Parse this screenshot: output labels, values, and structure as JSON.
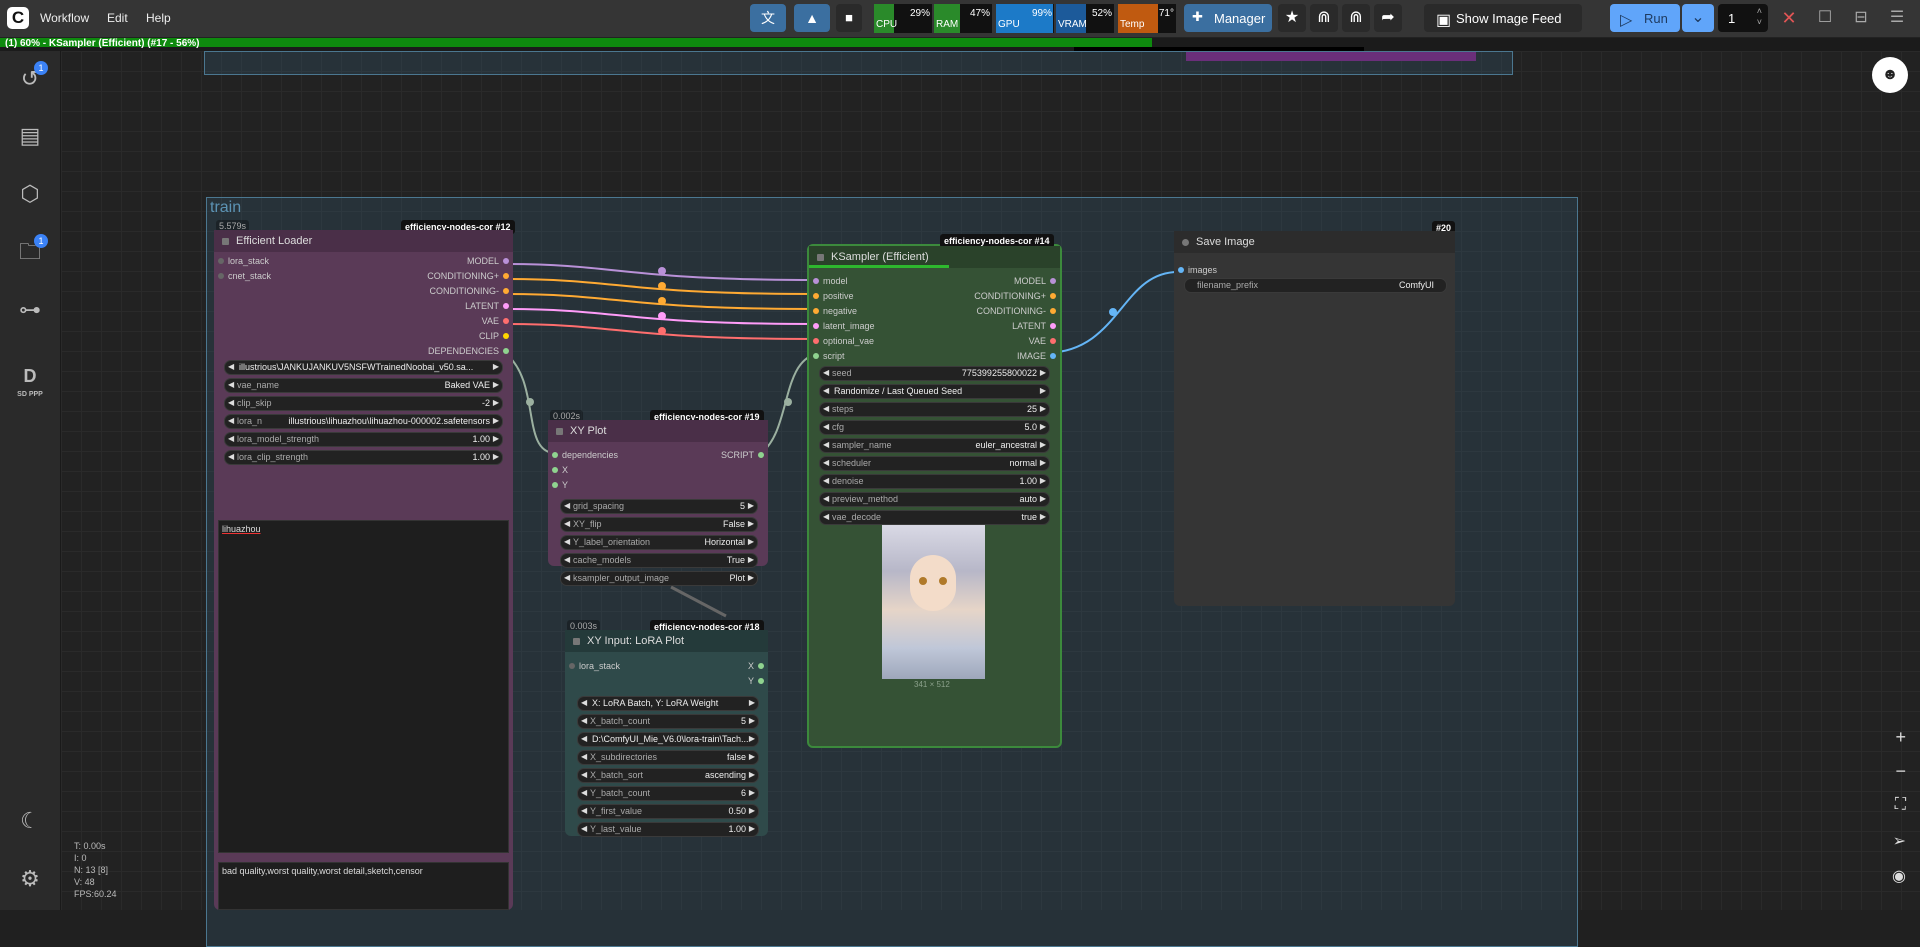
{
  "menu": {
    "workflow": "Workflow",
    "edit": "Edit",
    "help": "Help"
  },
  "stats": {
    "cpu": {
      "label": "CPU",
      "value": "29%",
      "pct": 29
    },
    "ram": {
      "label": "RAM",
      "value": "47%",
      "pct": 47
    },
    "gpu": {
      "label": "GPU",
      "value": "99%",
      "pct": 99
    },
    "vram": {
      "label": "VRAM",
      "value": "52%",
      "pct": 52
    },
    "temp": {
      "label": "Temp",
      "value": "71°",
      "pct": 71
    }
  },
  "toolbar": {
    "manager": "Manager",
    "show_feed": "Show Image Feed",
    "run": "Run",
    "queue_count": "1"
  },
  "progress": {
    "text": "(1) 60% - KSampler (Efficient) (#17 - 56%)",
    "value": 60
  },
  "sidebar": {
    "queue_badge": "1",
    "assets_badge": "1",
    "sd_label": "SD PPP"
  },
  "group": {
    "title": "train"
  },
  "loader": {
    "tag": "efficiency-nodes-cor  #12",
    "time": "5.579s",
    "title": "Efficient Loader",
    "inputs": [
      "lora_stack",
      "cnet_stack"
    ],
    "outputs": [
      "MODEL",
      "CONDITIONING+",
      "CONDITIONING-",
      "LATENT",
      "VAE",
      "CLIP",
      "DEPENDENCIES"
    ],
    "widgets": [
      {
        "label": "",
        "value": "illustrious\\JANKUJANKUV5NSFWTrainedNoobai_v50.sa..."
      },
      {
        "label": "vae_name",
        "value": "Baked VAE"
      },
      {
        "label": "clip_skip",
        "value": "-2"
      },
      {
        "label": "lora_n",
        "value": "illustrious\\lihuazhou\\lihuazhou-000002.safetensors"
      },
      {
        "label": "lora_model_strength",
        "value": "1.00"
      },
      {
        "label": "lora_clip_strength",
        "value": "1.00"
      }
    ],
    "positive": "lihuazhou",
    "negative": "bad quality,worst quality,worst detail,sketch,censor"
  },
  "xyplot": {
    "tag": "efficiency-nodes-cor  #19",
    "time": "0.002s",
    "title": "XY Plot",
    "inputs": [
      "dependencies",
      "X",
      "Y"
    ],
    "output": "SCRIPT",
    "widgets": [
      {
        "label": "grid_spacing",
        "value": "5"
      },
      {
        "label": "XY_flip",
        "value": "False"
      },
      {
        "label": "Y_label_orientation",
        "value": "Horizontal"
      },
      {
        "label": "cache_models",
        "value": "True"
      },
      {
        "label": "ksampler_output_image",
        "value": "Plot"
      }
    ]
  },
  "xyinput": {
    "tag": "efficiency-nodes-cor  #18",
    "time": "0.003s",
    "title": "XY Input: LoRA Plot",
    "input": "lora_stack",
    "outputs": [
      "X",
      "Y"
    ],
    "widgets": [
      {
        "label": "",
        "value": "X: LoRA Batch, Y: LoRA Weight"
      },
      {
        "label": "X_batch_count",
        "value": "5"
      },
      {
        "label": "",
        "value": "D:\\ComfyUI_Mie_V6.0\\lora-train\\Tach..."
      },
      {
        "label": "X_subdirectories",
        "value": "false"
      },
      {
        "label": "X_batch_sort",
        "value": "ascending"
      },
      {
        "label": "Y_batch_count",
        "value": "6"
      },
      {
        "label": "Y_first_value",
        "value": "0.50"
      },
      {
        "label": "Y_last_value",
        "value": "1.00"
      }
    ]
  },
  "ksampler": {
    "tag": "efficiency-nodes-cor  #14",
    "title": "KSampler (Efficient)",
    "inputs": [
      "model",
      "positive",
      "negative",
      "latent_image",
      "optional_vae",
      "script"
    ],
    "outputs": [
      "MODEL",
      "CONDITIONING+",
      "CONDITIONING-",
      "LATENT",
      "VAE",
      "IMAGE"
    ],
    "widgets": [
      {
        "label": "seed",
        "value": "775399255800022"
      },
      {
        "label": "",
        "value": "Randomize / Last Queued Seed"
      },
      {
        "label": "steps",
        "value": "25"
      },
      {
        "label": "cfg",
        "value": "5.0"
      },
      {
        "label": "sampler_name",
        "value": "euler_ancestral"
      },
      {
        "label": "scheduler",
        "value": "normal"
      },
      {
        "label": "denoise",
        "value": "1.00"
      },
      {
        "label": "preview_method",
        "value": "auto"
      },
      {
        "label": "vae_decode",
        "value": "true"
      }
    ],
    "image_size": "341 × 512"
  },
  "save": {
    "tag": "#20",
    "title": "Save Image",
    "input": "images",
    "filename_label": "filename_prefix",
    "filename_value": "ComfyUI"
  },
  "canvas_stats": [
    "T: 0.00s",
    "I: 0",
    "N: 13 [8]",
    "V: 48",
    "FPS:60.24"
  ],
  "colors": {
    "loader_bg": "#5a3a57",
    "ksampler_bg": "#355235",
    "xy_input_bg": "#2f4a4a",
    "save_bg": "#353535"
  }
}
